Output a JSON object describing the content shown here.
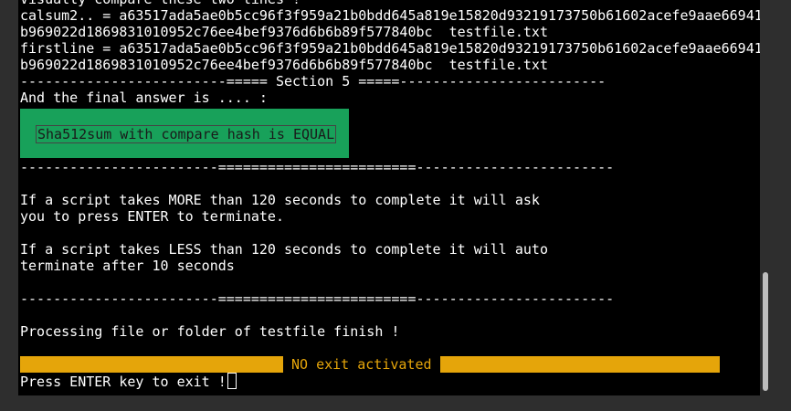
{
  "terminal": {
    "lines_top": [
      "Visually compare these two lines !",
      "calsum2.. = a63517ada5ae0b5cc96f3f959a21b0bdd645a819e15820d93219173750b61602acefe9aae66941",
      "b969022d1869831010952c76ee4bef9376d6b6b89f577840bc  testfile.txt",
      "firstline = a63517ada5ae0b5cc96f3f959a21b0bdd645a819e15820d93219173750b61602acefe9aae66941",
      "b969022d1869831010952c76ee4bef9376d6b6b89f577840bc  testfile.txt",
      "-------------------------===== Section 5 =====-------------------------",
      "And the final answer is .... :"
    ],
    "result_message": "Sha512sum with compare hash is EQUAL",
    "lines_middle": [
      "------------------------========================------------------------",
      "",
      "If a script takes MORE than 120 seconds to complete it will ask",
      "you to press ENTER to terminate.",
      "",
      "If a script takes LESS than 120 seconds to complete it will auto",
      "terminate after 10 seconds",
      "",
      "------------------------========================------------------------",
      "",
      "Processing file or folder of testfile finish !",
      ""
    ],
    "status_text": "NO exit activated",
    "prompt": "Press ENTER key to exit !"
  },
  "colors": {
    "background": "#000000",
    "text": "#ffffff",
    "result_box": "#18a15a",
    "status_bar": "#e5a50a",
    "scrollbar_thumb": "#bdbdbd"
  }
}
